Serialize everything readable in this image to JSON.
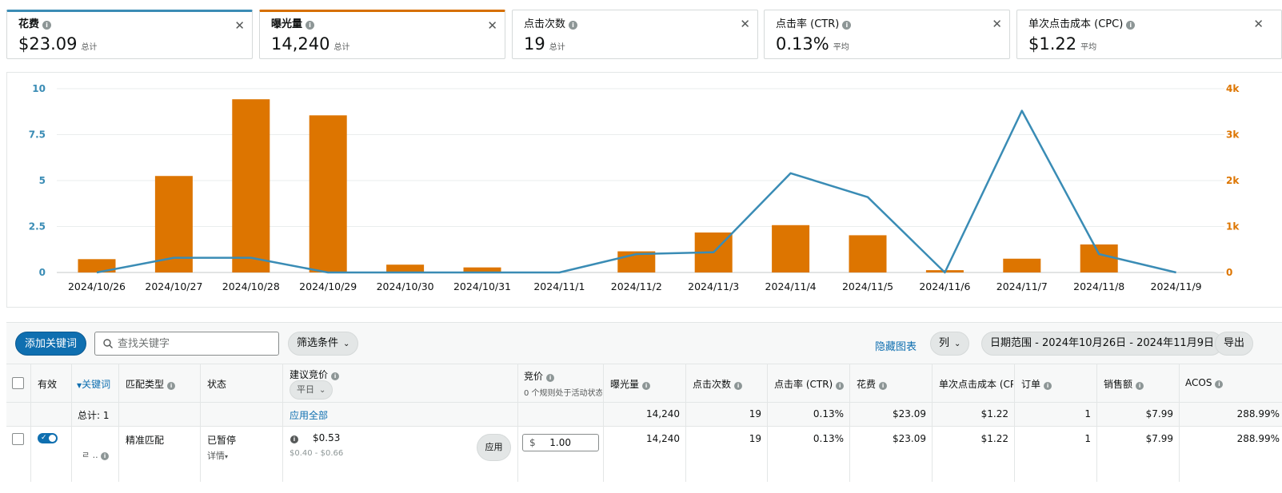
{
  "metrics": [
    {
      "title": "花费",
      "value": "$23.09",
      "sub": "总计",
      "color": "#3a8cb5"
    },
    {
      "title": "曝光量",
      "value": "14,240",
      "sub": "总计",
      "color": "#d66f00"
    },
    {
      "title": "点击次数",
      "value": "19",
      "sub": "总计"
    },
    {
      "title": "点击率 (CTR)",
      "value": "0.13%",
      "sub": "平均"
    },
    {
      "title": "单次点击成本 (CPC)",
      "value": "$1.22",
      "sub": "平均"
    }
  ],
  "chart_data": {
    "type": "bar",
    "categories": [
      "2024/10/26",
      "2024/10/27",
      "2024/10/28",
      "2024/10/29",
      "2024/10/30",
      "2024/10/31",
      "2024/11/1",
      "2024/11/2",
      "2024/11/3",
      "2024/11/4",
      "2024/11/5",
      "2024/11/6",
      "2024/11/7",
      "2024/11/8",
      "2024/11/9"
    ],
    "series": [
      {
        "name": "曝光量",
        "kind": "bar",
        "axis": "right",
        "color": "#dd7500",
        "values": [
          290,
          2100,
          3770,
          3420,
          170,
          110,
          0,
          460,
          870,
          1030,
          810,
          50,
          300,
          610,
          0
        ]
      },
      {
        "name": "花费",
        "kind": "line",
        "axis": "left",
        "color": "#3a8cb5",
        "values": [
          0,
          0.8,
          0.8,
          0,
          0,
          0,
          0,
          1.0,
          1.1,
          5.4,
          4.1,
          0,
          8.8,
          1.0,
          0
        ]
      }
    ],
    "left_axis": {
      "ticks": [
        "0",
        "2.5",
        "5",
        "7.5",
        "10"
      ],
      "range": [
        0,
        10
      ],
      "color": "#3a8cb5"
    },
    "right_axis": {
      "ticks": [
        "0",
        "1k",
        "2k",
        "3k",
        "4k"
      ],
      "range": [
        0,
        4000
      ],
      "color": "#dd7500"
    },
    "grid": true
  },
  "toolbar": {
    "add_keyword": "添加关键词",
    "search_placeholder": "查找关键字",
    "filter": "筛选条件",
    "hide_chart": "隐藏图表",
    "columns": "列",
    "date_range": "日期范围 - 2024年10月26日 - 2024年11月9日",
    "export": "导出"
  },
  "table": {
    "headers": {
      "active": "有效",
      "keyword": "关键词",
      "match_type": "匹配类型",
      "status": "状态",
      "suggested_bid": "建议竞价",
      "suggested_pill": "平日",
      "bid": "竞价",
      "bid_sub": "0 个规则处于活动状态",
      "impressions": "曝光量",
      "clicks": "点击次数",
      "ctr": "点击率 (CTR)",
      "spend": "花费",
      "cpc": "单次点击成本 (CPC)",
      "orders": "订单",
      "sales": "销售额",
      "acos": "ACOS"
    },
    "totals": {
      "label": "总计: 1",
      "apply_all": "应用全部",
      "impressions": "14,240",
      "clicks": "19",
      "ctr": "0.13%",
      "spend": "$23.09",
      "cpc": "$1.22",
      "orders": "1",
      "sales": "$7.99",
      "acos": "288.99%"
    },
    "row": {
      "keyword": "ㄹ ..",
      "match_type": "精准匹配",
      "status": "已暂停",
      "details": "详情",
      "suggested_bid": "$0.53",
      "suggested_range": "$0.40 - $0.66",
      "apply": "应用",
      "bid_currency": "$",
      "bid_value": "1.00",
      "impressions": "14,240",
      "clicks": "19",
      "ctr": "0.13%",
      "spend": "$23.09",
      "cpc": "$1.22",
      "orders": "1",
      "sales": "$7.99",
      "acos": "288.99%"
    }
  }
}
